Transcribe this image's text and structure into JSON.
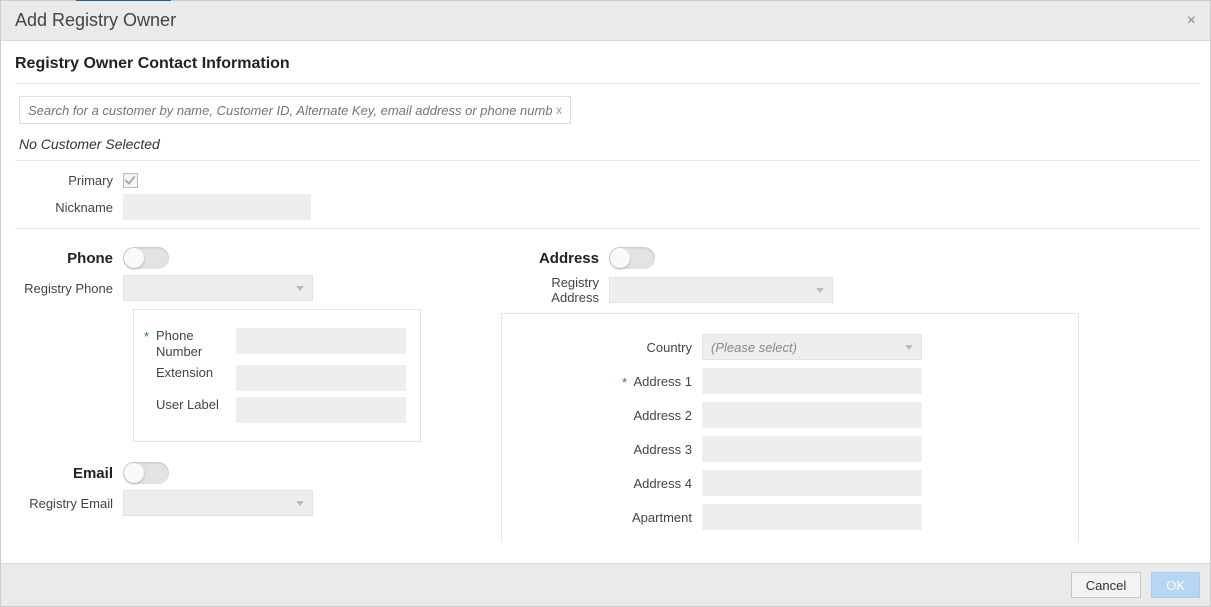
{
  "dialog": {
    "title": "Add Registry Owner",
    "close_icon": "×"
  },
  "section": {
    "title": "Registry Owner Contact Information"
  },
  "search": {
    "placeholder": "Search for a customer by name, Customer ID, Alternate Key, email address or phone number.",
    "value": "",
    "clear_icon": "x"
  },
  "status": {
    "no_customer": "No Customer Selected"
  },
  "basic": {
    "primary_label": "Primary",
    "primary_checked": true,
    "nickname_label": "Nickname",
    "nickname_value": ""
  },
  "phone": {
    "heading": "Phone",
    "toggle_on": false,
    "registry_phone_label": "Registry Phone",
    "registry_phone_value": "",
    "number_label": "Phone Number",
    "number_value": "",
    "extension_label": "Extension",
    "extension_value": "",
    "user_label_label": "User Label",
    "user_label_value": ""
  },
  "email": {
    "heading": "Email",
    "toggle_on": false,
    "registry_email_label": "Registry Email",
    "registry_email_value": ""
  },
  "address": {
    "heading": "Address",
    "toggle_on": false,
    "registry_address_label": "Registry Address",
    "registry_address_value": "",
    "country_label": "Country",
    "country_placeholder": "(Please select)",
    "address1_label": "Address 1",
    "address1_value": "",
    "address2_label": "Address 2",
    "address2_value": "",
    "address3_label": "Address 3",
    "address3_value": "",
    "address4_label": "Address 4",
    "address4_value": "",
    "apartment_label": "Apartment",
    "apartment_value": ""
  },
  "footer": {
    "cancel": "Cancel",
    "ok": "OK"
  }
}
